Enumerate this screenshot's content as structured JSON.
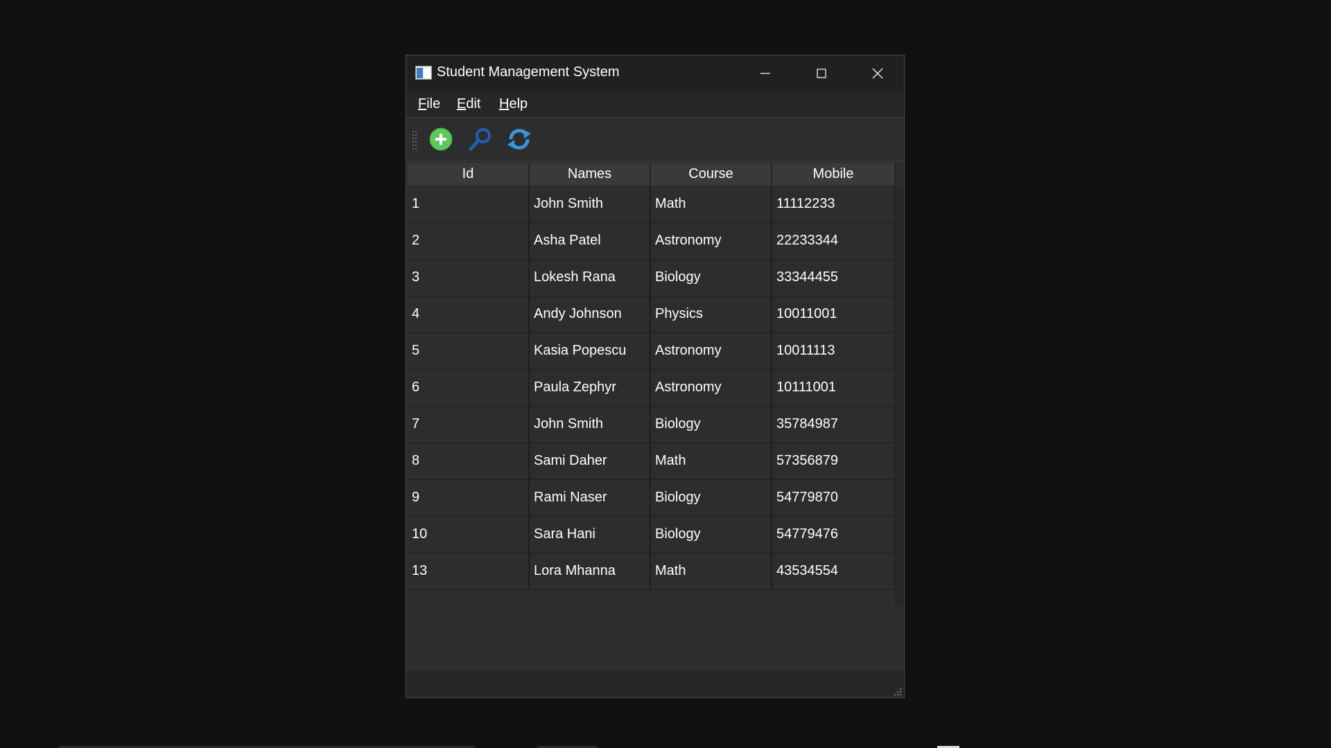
{
  "window": {
    "title": "Student Management System"
  },
  "menu": {
    "file": {
      "accel": "F",
      "rest": "ile"
    },
    "edit": {
      "accel": "E",
      "rest": "dit"
    },
    "help": {
      "accel": "H",
      "rest": "elp"
    }
  },
  "toolbar": {
    "icons": [
      "add-icon",
      "search-icon",
      "refresh-icon"
    ]
  },
  "table": {
    "columns": [
      "Id",
      "Names",
      "Course",
      "Mobile"
    ],
    "rows": [
      [
        "1",
        "John Smith",
        "Math",
        "11112233"
      ],
      [
        "2",
        "Asha Patel",
        "Astronomy",
        "22233344"
      ],
      [
        "3",
        "Lokesh Rana",
        "Biology",
        "33344455"
      ],
      [
        "4",
        "Andy Johnson",
        "Physics",
        "10011001"
      ],
      [
        "5",
        "Kasia Popescu",
        "Astronomy",
        "10011113"
      ],
      [
        "6",
        "Paula Zephyr",
        "Astronomy",
        "10111001"
      ],
      [
        "7",
        "John Smith",
        "Biology",
        "35784987"
      ],
      [
        "8",
        "Sami Daher",
        "Math",
        "57356879"
      ],
      [
        "9",
        "Rami Naser",
        "Biology",
        "54779870"
      ],
      [
        "10",
        "Sara Hani",
        "Biology",
        "54779476"
      ],
      [
        "13",
        "Lora Mhanna",
        "Math",
        "43534554"
      ]
    ]
  },
  "colors": {
    "window_bg": "#2d2d2d",
    "titlebar_bg": "#202020",
    "header_bg": "#3a3a3a",
    "desktop_bg": "#111111",
    "add_green": "#5cc85c",
    "search_blue": "#1f5fb4",
    "refresh_blue": "#3a96dd"
  }
}
